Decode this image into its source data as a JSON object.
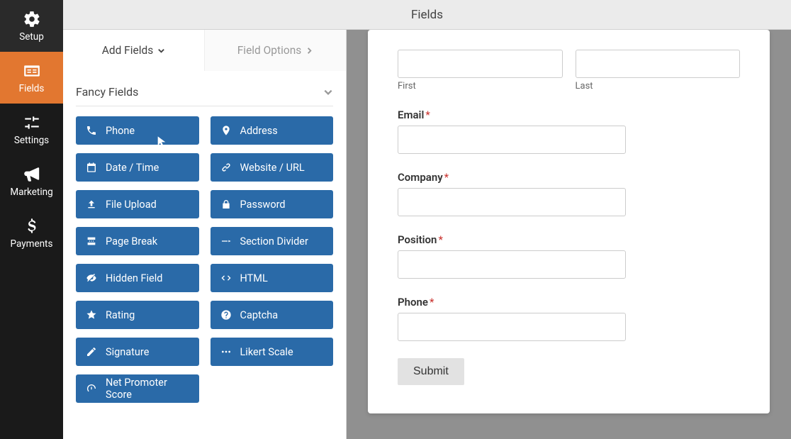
{
  "top": {
    "title": "Fields"
  },
  "nav": {
    "items": [
      {
        "key": "setup",
        "label": "Setup"
      },
      {
        "key": "fields",
        "label": "Fields"
      },
      {
        "key": "settings",
        "label": "Settings"
      },
      {
        "key": "marketing",
        "label": "Marketing"
      },
      {
        "key": "payments",
        "label": "Payments"
      }
    ],
    "active": "fields"
  },
  "panel": {
    "tabs": {
      "add": "Add Fields",
      "options": "Field Options"
    },
    "active_tab": "add",
    "group_title": "Fancy Fields",
    "fields": [
      {
        "icon": "phone",
        "label": "Phone"
      },
      {
        "icon": "pin",
        "label": "Address"
      },
      {
        "icon": "calendar",
        "label": "Date / Time"
      },
      {
        "icon": "link",
        "label": "Website / URL"
      },
      {
        "icon": "upload",
        "label": "File Upload"
      },
      {
        "icon": "lock",
        "label": "Password"
      },
      {
        "icon": "pagebreak",
        "label": "Page Break"
      },
      {
        "icon": "divider",
        "label": "Section Divider"
      },
      {
        "icon": "eye-off",
        "label": "Hidden Field"
      },
      {
        "icon": "code",
        "label": "HTML"
      },
      {
        "icon": "star",
        "label": "Rating"
      },
      {
        "icon": "help",
        "label": "Captcha"
      },
      {
        "icon": "pencil",
        "label": "Signature"
      },
      {
        "icon": "dots",
        "label": "Likert Scale"
      },
      {
        "icon": "gauge",
        "label": "Net Promoter Score"
      }
    ]
  },
  "preview": {
    "name": {
      "first_sublabel": "First",
      "last_sublabel": "Last"
    },
    "fields": [
      {
        "label": "Email",
        "required": true
      },
      {
        "label": "Company",
        "required": true
      },
      {
        "label": "Position",
        "required": true
      },
      {
        "label": "Phone",
        "required": true
      }
    ],
    "submit_label": "Submit"
  },
  "colors": {
    "accent": "#e27730",
    "button": "#2a6aa8"
  }
}
